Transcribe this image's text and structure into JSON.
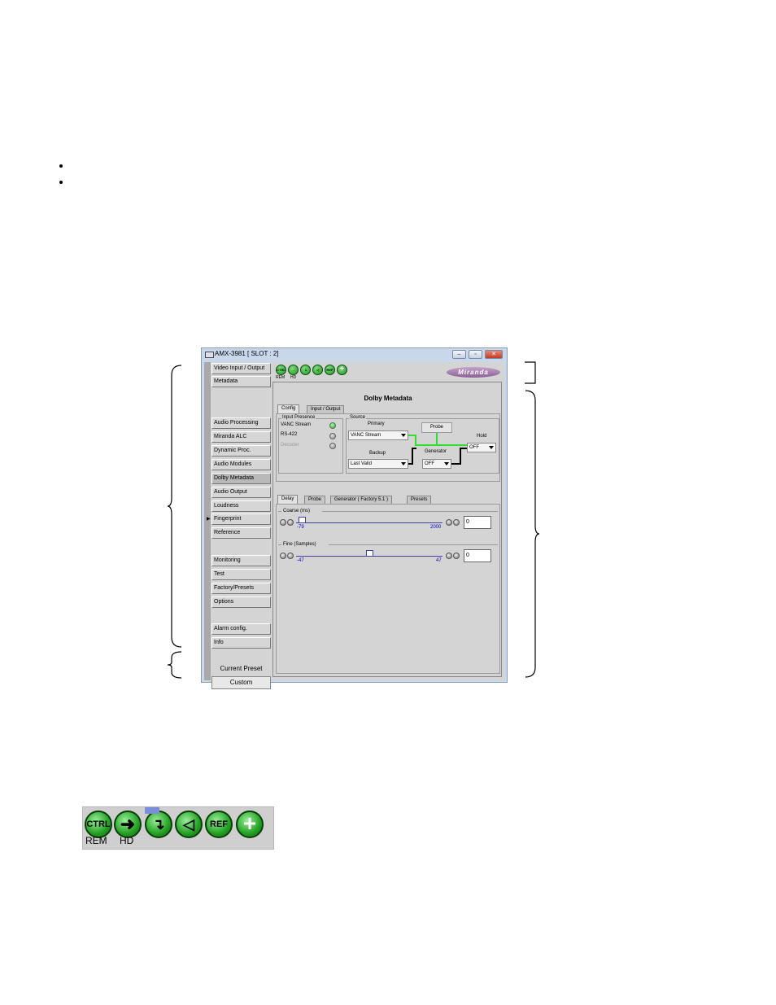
{
  "window": {
    "title": "AMX-3981 [ SLOT : 2]",
    "min_label": "–",
    "max_label": "▫",
    "close_label": "✕"
  },
  "nav": {
    "items": [
      {
        "label": "Video Input / Output"
      },
      {
        "label": "Metadata"
      },
      {
        "label": "Audio Processing"
      },
      {
        "label": "Miranda ALC"
      },
      {
        "label": "Dynamic Proc."
      },
      {
        "label": "Audio Modules"
      },
      {
        "label": "Dolby Metadata",
        "selected": true
      },
      {
        "label": "Audio Output"
      },
      {
        "label": "Loudness"
      },
      {
        "label": "Fingerprint"
      },
      {
        "label": "Reference"
      },
      {
        "label": "Monitoring"
      },
      {
        "label": "Test"
      },
      {
        "label": "Factory/Presets"
      },
      {
        "label": "Options"
      },
      {
        "label": "Alarm config."
      },
      {
        "label": "Info"
      }
    ],
    "preset_label": "Current Preset",
    "preset_value": "Custom"
  },
  "toolbar": {
    "icons": [
      "ctrl-icon",
      "arrow-right-icon",
      "input-arrow-icon",
      "speaker-icon",
      "ref-icon",
      "plus-icon"
    ],
    "ctrl_text": "CTRL",
    "ref_text": "REF",
    "rem_label": "REM",
    "hd_label": "HD",
    "logo_text": "Miranda"
  },
  "panel": {
    "title": "Dolby Metadata",
    "tabs": [
      "Config",
      "Input / Output"
    ],
    "input_presence": {
      "label": "Input Presence",
      "rows": [
        {
          "label": "VANC Stream",
          "state": "on"
        },
        {
          "label": "RS-422",
          "state": "off"
        },
        {
          "label": "Decoder",
          "state": "off"
        }
      ]
    },
    "source": {
      "label": "Source",
      "primary_label": "Primary",
      "primary_value": "VANC Stream",
      "backup_label": "Backup",
      "backup_value": "Last Valid",
      "probe_label": "Probe",
      "generator_label": "Generator",
      "generator_value": "OFF",
      "hold_label": "Hold",
      "hold_value": "OFF"
    },
    "subtabs": [
      "Delay",
      "Probe",
      "Generator ( Factory 5.1 )",
      "Presets"
    ],
    "coarse": {
      "label": "Coarse (ms)",
      "min": "-79",
      "max": "2000",
      "value": "0",
      "position": 0.038
    },
    "fine": {
      "label": "Fine (Samples)",
      "min": "-47",
      "max": "47",
      "value": "0",
      "position": 0.5
    }
  },
  "large_toolbar": {
    "ctrl_text": "CTRL",
    "ref_text": "REF",
    "rem_label": "REM",
    "hd_label": "HD"
  }
}
